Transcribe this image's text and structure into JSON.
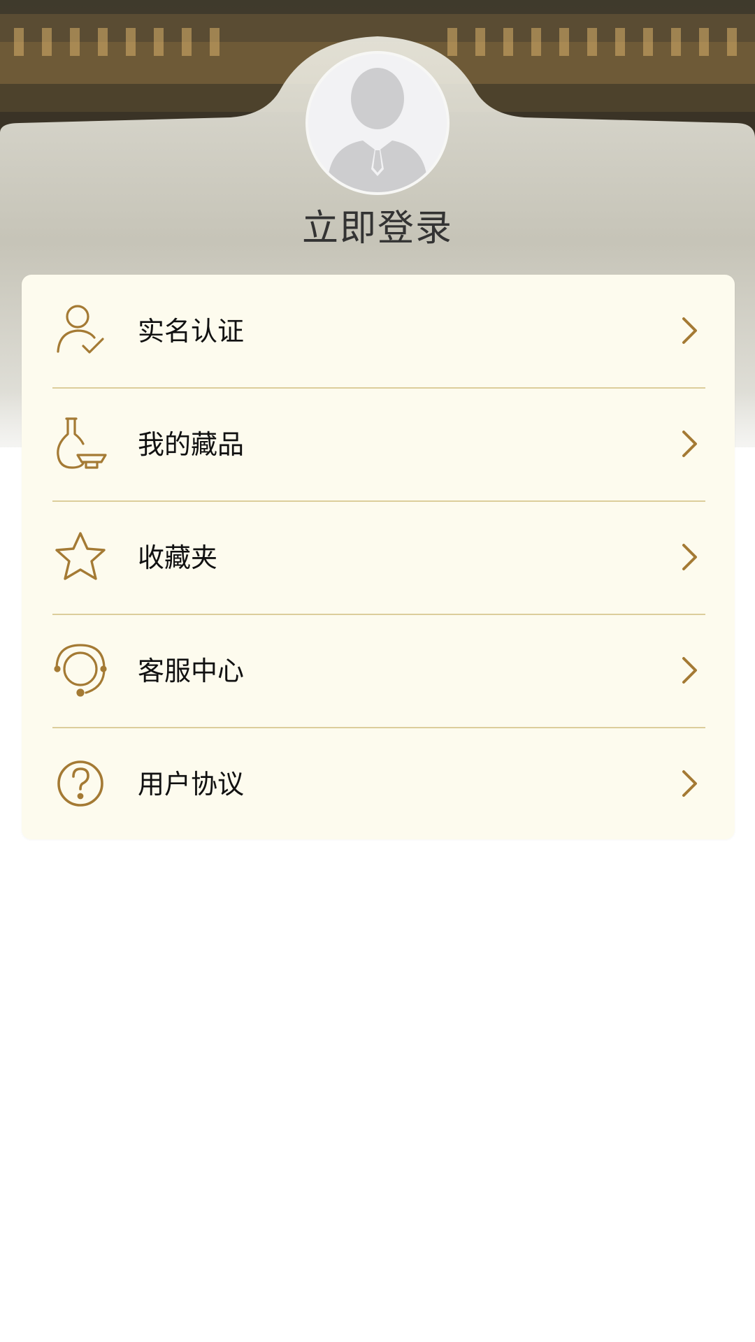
{
  "profile": {
    "login_label": "立即登录",
    "avatar_icon": "default-user-avatar-icon"
  },
  "menu": {
    "items": [
      {
        "label": "实名认证",
        "icon": "user-check-icon"
      },
      {
        "label": "我的藏品",
        "icon": "vase-icon"
      },
      {
        "label": "收藏夹",
        "icon": "star-icon"
      },
      {
        "label": "客服中心",
        "icon": "headset-icon"
      },
      {
        "label": "用户协议",
        "icon": "question-circle-icon"
      }
    ],
    "chevron_icon": "chevron-right-icon"
  },
  "colors": {
    "accent": "#a47a34",
    "card_bg": "#fdfbee",
    "divider": "#dccd9b",
    "title_text": "#333333",
    "page_bg": "#ffffff"
  }
}
